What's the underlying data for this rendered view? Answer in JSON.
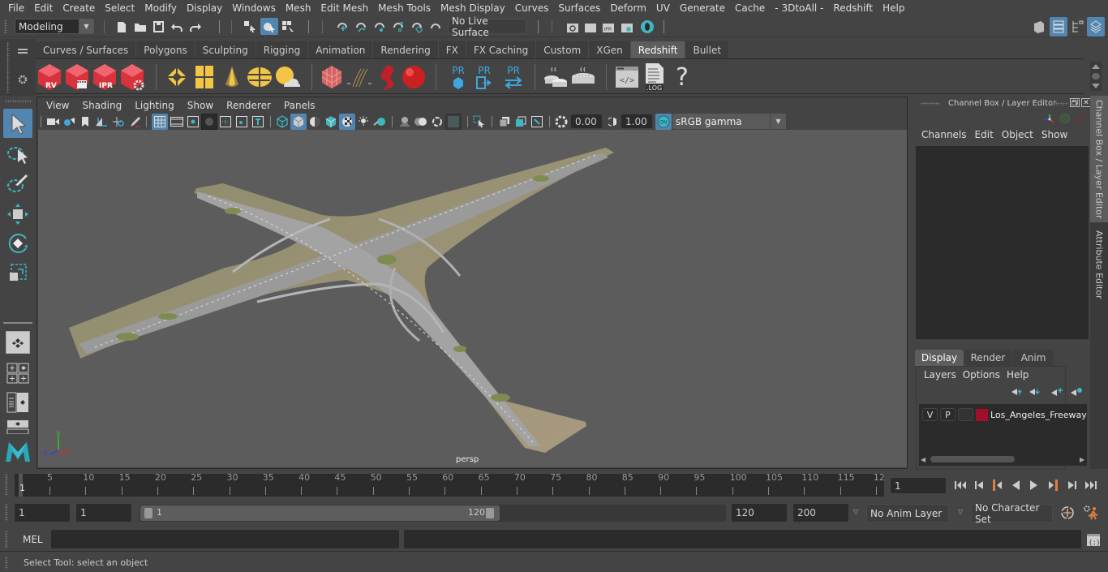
{
  "menubar": {
    "items": [
      "File",
      "Edit",
      "Create",
      "Select",
      "Modify",
      "Display",
      "Windows",
      "Mesh",
      "Edit Mesh",
      "Mesh Tools",
      "Mesh Display",
      "Curves",
      "Surfaces",
      "Deform",
      "UV",
      "Generate",
      "Cache",
      "- 3DtoAll -",
      "Redshift",
      "Help"
    ]
  },
  "statusline": {
    "workspace": "Modeling",
    "live_surface": "No Live Surface"
  },
  "shelf": {
    "tabs": [
      "Curves / Surfaces",
      "Polygons",
      "Sculpting",
      "Rigging",
      "Animation",
      "Rendering",
      "FX",
      "FX Caching",
      "Custom",
      "XGen",
      "Redshift",
      "Bullet"
    ],
    "active_tab": "Redshift",
    "icons": {
      "rv": "RV",
      "ipr": "IPR",
      "pr": "PR",
      "log": ".LOG",
      "help": "?"
    }
  },
  "viewport": {
    "menu": [
      "View",
      "Shading",
      "Lighting",
      "Show",
      "Renderer",
      "Panels"
    ],
    "exposure": "0.00",
    "gamma": "1.00",
    "color_mgmt_on": "ON",
    "color_space": "sRGB gamma",
    "camera_label": "persp",
    "axis": {
      "x": "x",
      "y": "y",
      "z": "z"
    },
    "axis_colors": {
      "x": "#d03030",
      "y": "#30c030",
      "z": "#3040e0"
    }
  },
  "channelbox": {
    "title": "Channel Box / Layer Editor",
    "menu": [
      "Channels",
      "Edit",
      "Object",
      "Show"
    ],
    "layer_tabs": [
      "Display",
      "Render",
      "Anim"
    ],
    "active_layer_tab": "Display",
    "layer_menu": [
      "Layers",
      "Options",
      "Help"
    ],
    "layers": [
      {
        "v": "V",
        "p": "P",
        "name": "Los_Angeles_Freeway",
        "color": "#a0102a"
      }
    ]
  },
  "sidetabs": [
    "Channel Box / Layer Editor",
    "Attribute Editor"
  ],
  "timeline": {
    "ticks": [
      "5",
      "10",
      "15",
      "20",
      "25",
      "30",
      "35",
      "40",
      "45",
      "50",
      "55",
      "60",
      "65",
      "70",
      "75",
      "80",
      "85",
      "90",
      "95",
      "100",
      "105",
      "110",
      "115",
      "12"
    ],
    "current_frame_marker": "1",
    "current_frame": "1"
  },
  "range": {
    "start": "1",
    "playback_start": "1",
    "slider_start": "1",
    "slider_end": "120",
    "playback_end": "120",
    "end": "200",
    "anim_layer": "No Anim Layer",
    "character_set": "No Character Set"
  },
  "cmdline": {
    "label": "MEL"
  },
  "helpline": {
    "text": "Select Tool: select an object"
  },
  "colors": {
    "accent": "#5285b0",
    "teal": "#3fb6c4",
    "redshift_red": "#d8323c",
    "yellow": "#f3c545"
  }
}
